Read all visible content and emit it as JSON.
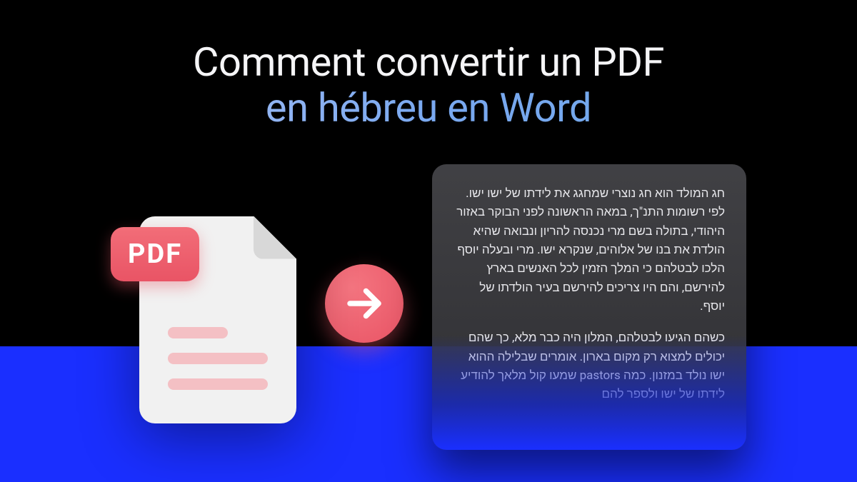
{
  "title": {
    "line1": "Comment convertir un PDF",
    "line2": "en hébreu en Word"
  },
  "pdf": {
    "badge": "PDF"
  },
  "hebrew": {
    "para1": "חג המולד הוא חג נוצרי שמחגג את לידתו של ישו ישו. לפי רשומות התנ\"ך, במאה הראשונה לפני הבוקר באזור היהודי, בתולה בשם מרי נכנסה להריון ונבואה שהיא הולדת את בנו של אלוהים, שנקרא ישו. מרי ובעלה יוסף הלכו לבטלהם כי המלך הזמין לכל האנשים בארץ להירשם, והם היו צריכים להירשם בעיר הולדתו של יוסף.",
    "para2": "כשהם הגיעו לבטלהם, המלון היה כבר מלא, כך שהם יכולים למצוא רק מקום בארון. אומרים שבלילה ההוא ישו נולד במזנון. כמה pastors שמעו קול מלאך להודיע לידתו של ישו ולספר להם"
  }
}
